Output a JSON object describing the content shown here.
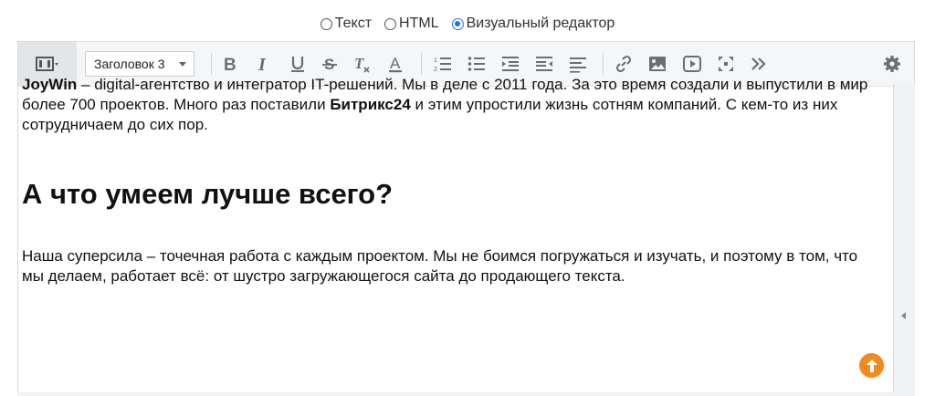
{
  "modes": [
    {
      "label": "Текст",
      "checked": false
    },
    {
      "label": "HTML",
      "checked": false
    },
    {
      "label": "Визуальный редактор",
      "checked": true
    }
  ],
  "toolbar": {
    "format_select": "Заголовок 3",
    "buttons": [
      "bold-icon",
      "italic-icon",
      "underline-icon",
      "strikethrough-icon",
      "clear-format-icon",
      "text-color-icon",
      "ordered-list-icon",
      "bullet-list-icon",
      "indent-icon",
      "outdent-icon",
      "align-icon",
      "link-icon",
      "image-icon",
      "video-icon",
      "fullscreen-icon",
      "more-icon",
      "settings-icon"
    ]
  },
  "content": {
    "p1_bold1": "JoyWin",
    "p1_text1": " – digital-агентство и интегратор IT-решений. Мы в деле с 2011 года. За это время создали и выпустили в мир более 700 проектов. Много раз поставили ",
    "p1_bold2": "Битрикс24",
    "p1_text2": " и этим упростили жизнь сотням компаний. С кем-то из них сотрудничаем до сих пор.",
    "heading": "А что умеем лучше всего?",
    "p2": "Наша суперсила – точечная работа с каждым проектом. Мы не боимся погружаться и изучать, и поэтому в том, что мы делаем, работает всё: от шустро загружающегося сайта до продающего текста."
  },
  "colors": {
    "accent": "#1a73e8",
    "up_button": "#f28a1e"
  }
}
